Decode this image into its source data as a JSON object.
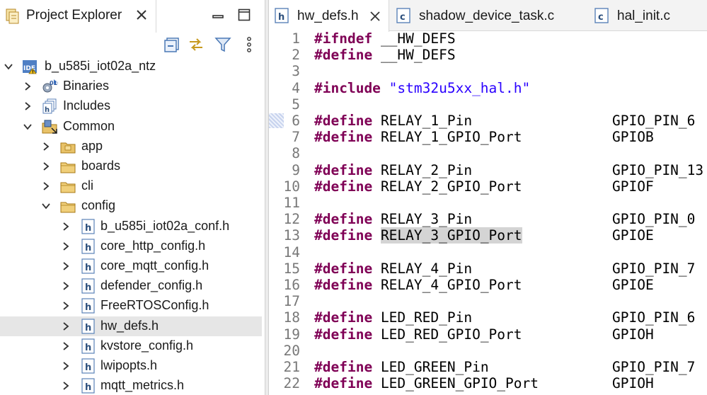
{
  "explorer": {
    "title": "Project Explorer",
    "toolbar_icons": [
      "collapse-all-icon",
      "link-with-editor-icon",
      "filter-icon",
      "view-menu-icon"
    ],
    "tree": [
      {
        "label": "b_u585i_iot02a_ntz",
        "depth": 0,
        "expanded": true,
        "icon": "ide-project-icon"
      },
      {
        "label": "Binaries",
        "depth": 1,
        "expanded": false,
        "icon": "binaries-icon"
      },
      {
        "label": "Includes",
        "depth": 1,
        "expanded": false,
        "icon": "includes-icon"
      },
      {
        "label": "Common",
        "depth": 1,
        "expanded": true,
        "icon": "linked-folder-icon"
      },
      {
        "label": "app",
        "depth": 2,
        "expanded": false,
        "icon": "source-folder-icon"
      },
      {
        "label": "boards",
        "depth": 2,
        "expanded": false,
        "icon": "folder-icon"
      },
      {
        "label": "cli",
        "depth": 2,
        "expanded": false,
        "icon": "folder-icon"
      },
      {
        "label": "config",
        "depth": 2,
        "expanded": true,
        "icon": "folder-icon"
      },
      {
        "label": "b_u585i_iot02a_conf.h",
        "depth": 3,
        "expanded": false,
        "icon": "header-file-icon"
      },
      {
        "label": "core_http_config.h",
        "depth": 3,
        "expanded": false,
        "icon": "header-file-icon"
      },
      {
        "label": "core_mqtt_config.h",
        "depth": 3,
        "expanded": false,
        "icon": "header-file-icon"
      },
      {
        "label": "defender_config.h",
        "depth": 3,
        "expanded": false,
        "icon": "header-file-icon"
      },
      {
        "label": "FreeRTOSConfig.h",
        "depth": 3,
        "expanded": false,
        "icon": "header-file-icon"
      },
      {
        "label": "hw_defs.h",
        "depth": 3,
        "expanded": false,
        "icon": "header-file-icon",
        "selected": true
      },
      {
        "label": "kvstore_config.h",
        "depth": 3,
        "expanded": false,
        "icon": "header-file-icon"
      },
      {
        "label": "lwipopts.h",
        "depth": 3,
        "expanded": false,
        "icon": "header-file-icon"
      },
      {
        "label": "mqtt_metrics.h",
        "depth": 3,
        "expanded": false,
        "icon": "header-file-icon"
      }
    ]
  },
  "editor": {
    "tabs": [
      {
        "label": "hw_defs.h",
        "type": "h",
        "active": true
      },
      {
        "label": "shadow_device_task.c",
        "type": "c",
        "active": false
      },
      {
        "label": "hal_init.c",
        "type": "c",
        "active": false
      }
    ],
    "lines": [
      {
        "n": "1",
        "kw": "#ifndef",
        "name": "__HW_DEFS",
        "value": "",
        "str": ""
      },
      {
        "n": "2",
        "kw": "#define",
        "name": "__HW_DEFS",
        "value": "",
        "str": ""
      },
      {
        "n": "3",
        "kw": "",
        "name": "",
        "value": "",
        "str": ""
      },
      {
        "n": "4",
        "kw": "#include",
        "name": "",
        "value": "",
        "str": "\"stm32u5xx_hal.h\""
      },
      {
        "n": "5",
        "kw": "",
        "name": "",
        "value": "",
        "str": ""
      },
      {
        "n": "6",
        "kw": "#define",
        "name": "RELAY_1_Pin",
        "value": "GPIO_PIN_6",
        "str": ""
      },
      {
        "n": "7",
        "kw": "#define",
        "name": "RELAY_1_GPIO_Port",
        "value": "GPIOB",
        "str": ""
      },
      {
        "n": "8",
        "kw": "",
        "name": "",
        "value": "",
        "str": ""
      },
      {
        "n": "9",
        "kw": "#define",
        "name": "RELAY_2_Pin",
        "value": "GPIO_PIN_13",
        "str": ""
      },
      {
        "n": "10",
        "kw": "#define",
        "name": "RELAY_2_GPIO_Port",
        "value": "GPIOF",
        "str": ""
      },
      {
        "n": "11",
        "kw": "",
        "name": "",
        "value": "",
        "str": ""
      },
      {
        "n": "12",
        "kw": "#define",
        "name": "RELAY_3_Pin",
        "value": "GPIO_PIN_0",
        "str": ""
      },
      {
        "n": "13",
        "kw": "#define",
        "name": "RELAY_3_GPIO_Port",
        "value": "GPIOE",
        "str": "",
        "highlight": true
      },
      {
        "n": "14",
        "kw": "",
        "name": "",
        "value": "",
        "str": ""
      },
      {
        "n": "15",
        "kw": "#define",
        "name": "RELAY_4_Pin",
        "value": "GPIO_PIN_7",
        "str": ""
      },
      {
        "n": "16",
        "kw": "#define",
        "name": "RELAY_4_GPIO_Port",
        "value": "GPIOE",
        "str": ""
      },
      {
        "n": "17",
        "kw": "",
        "name": "",
        "value": "",
        "str": ""
      },
      {
        "n": "18",
        "kw": "#define",
        "name": "LED_RED_Pin",
        "value": "GPIO_PIN_6",
        "str": ""
      },
      {
        "n": "19",
        "kw": "#define",
        "name": "LED_RED_GPIO_Port",
        "value": "GPIOH",
        "str": ""
      },
      {
        "n": "20",
        "kw": "",
        "name": "",
        "value": "",
        "str": ""
      },
      {
        "n": "21",
        "kw": "#define",
        "name": "LED_GREEN_Pin",
        "value": "GPIO_PIN_7",
        "str": ""
      },
      {
        "n": "22",
        "kw": "#define",
        "name": "LED_GREEN_GPIO_Port",
        "value": "GPIOH",
        "str": ""
      }
    ]
  },
  "colors": {
    "keyword": "#7f0055",
    "string": "#2a00ff",
    "line_number": "#787878",
    "selection": "#e6e6e6",
    "occurrence_highlight": "#d4d4d4"
  }
}
